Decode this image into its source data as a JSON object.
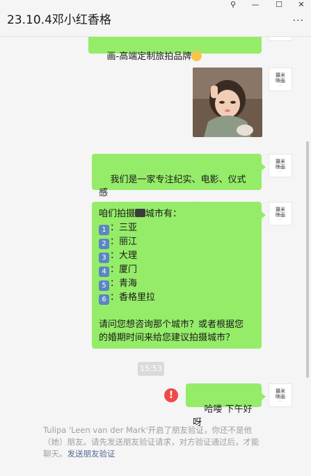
{
  "window": {
    "title": "23.10.4邓小红香格",
    "pin_glyph": "⚲",
    "minimize_glyph": "—",
    "maximize_glyph": "☐",
    "close_glyph": "✕",
    "more_glyph": "···"
  },
  "messages": {
    "m1": {
      "text": "画-高端定制旅拍品牌"
    },
    "m3": {
      "text": "我们是一家专注纪实、电影、仪式感\n风格的定制化摄影工作室"
    },
    "m4": {
      "intro_before": "咱们拍摄",
      "intro_after": "城市有：",
      "cities": [
        {
          "num": "1",
          "name": "：三亚"
        },
        {
          "num": "2",
          "name": "：丽江"
        },
        {
          "num": "3",
          "name": "：大理"
        },
        {
          "num": "4",
          "name": "：厦门"
        },
        {
          "num": "5",
          "name": "：青海"
        },
        {
          "num": "6",
          "name": "：香格里拉"
        }
      ],
      "question": "请问您想咨询那个城市？或者根据您\n的婚期时间来给您建议拍摄城市？"
    },
    "timestamp": "15:53",
    "m5": {
      "text": "哈喽 下午好呀",
      "error_glyph": "!"
    }
  },
  "avatar": {
    "line1": "摄米",
    "line2": "映画",
    "line3": "——"
  },
  "notice": {
    "text": "Tulipa 'Leen van der Mark'开启了朋友验证，你还不是他（她）朋友。请先发送朋友验证请求，对方验证通过后，才能聊天。",
    "link": "发送朋友验证"
  },
  "colors": {
    "bubble": "#95ec69",
    "background": "#f5f5f5",
    "link": "#576b95",
    "error": "#f04848"
  }
}
